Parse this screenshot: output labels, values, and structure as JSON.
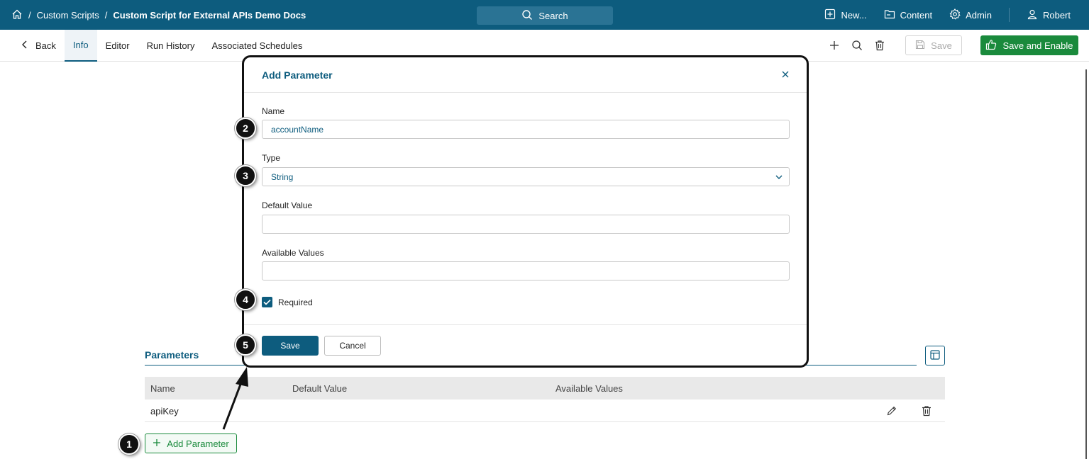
{
  "topbar": {
    "breadcrumb": [
      "Custom Scripts",
      "Custom Script for External APIs Demo Docs"
    ],
    "search_label": "Search",
    "nav": [
      "New...",
      "Content",
      "Admin",
      "Robert"
    ]
  },
  "toolbar": {
    "back_label": "Back",
    "tabs": [
      "Info",
      "Editor",
      "Run History",
      "Associated Schedules"
    ],
    "active_tab": "Info",
    "save_label": "Save",
    "save_enable_label": "Save and Enable"
  },
  "modal": {
    "title": "Add Parameter",
    "name_label": "Name",
    "name_value": "accountName",
    "type_label": "Type",
    "type_value": "String",
    "default_label": "Default Value",
    "default_value": "",
    "available_label": "Available Values",
    "available_value": "",
    "required_label": "Required",
    "required_checked": true,
    "save_label": "Save",
    "cancel_label": "Cancel"
  },
  "parameters": {
    "title": "Parameters",
    "columns": [
      "Name",
      "Default Value",
      "Available Values"
    ],
    "rows": [
      {
        "name": "apiKey",
        "default": "",
        "available": ""
      }
    ],
    "add_label": "Add Parameter"
  },
  "steps": [
    "1",
    "2",
    "3",
    "4",
    "5"
  ],
  "colors": {
    "brand": "#0d5c7e",
    "success": "#1a8a3c",
    "marker": "#111111"
  },
  "icons": [
    "home-icon",
    "search-icon",
    "plus-square-icon",
    "folder-icon",
    "gear-icon",
    "user-icon",
    "chevron-left-icon",
    "plus-icon",
    "trash-icon",
    "save-icon",
    "thumbs-up-icon",
    "close-icon",
    "chevron-down-icon",
    "check-icon",
    "layout-icon",
    "pencil-icon"
  ]
}
